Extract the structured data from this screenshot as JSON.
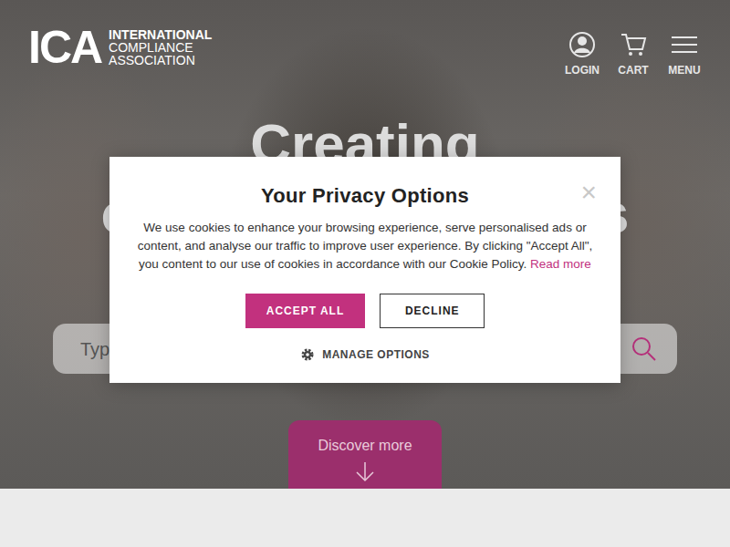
{
  "header": {
    "logo": {
      "mark": "ICA",
      "lines": [
        "INTERNATIONAL",
        "COMPLIANCE",
        "ASSOCIATION"
      ]
    },
    "nav": [
      {
        "label": "LOGIN"
      },
      {
        "label": "CART"
      },
      {
        "label": "MENU"
      }
    ]
  },
  "hero": {
    "heading": [
      "Creating",
      "compliance careers"
    ],
    "search": {
      "placeholder": "Type"
    },
    "discover": "Discover more"
  },
  "cookie_dialog": {
    "title": "Your Privacy Options",
    "text": "We use cookies to enhance your browsing experience, serve personalised ads or content, and analyse our traffic to improve user experience. By clicking \"Accept All\", you content to our use of cookies in accordance with our Cookie Policy.",
    "link": "Read more",
    "close": "×",
    "buttons": [
      {
        "label": "ACCEPT ALL",
        "kind": "filled"
      },
      {
        "label": "DECLINE",
        "kind": "outline"
      }
    ],
    "manage": "MANAGE OPTIONS"
  }
}
